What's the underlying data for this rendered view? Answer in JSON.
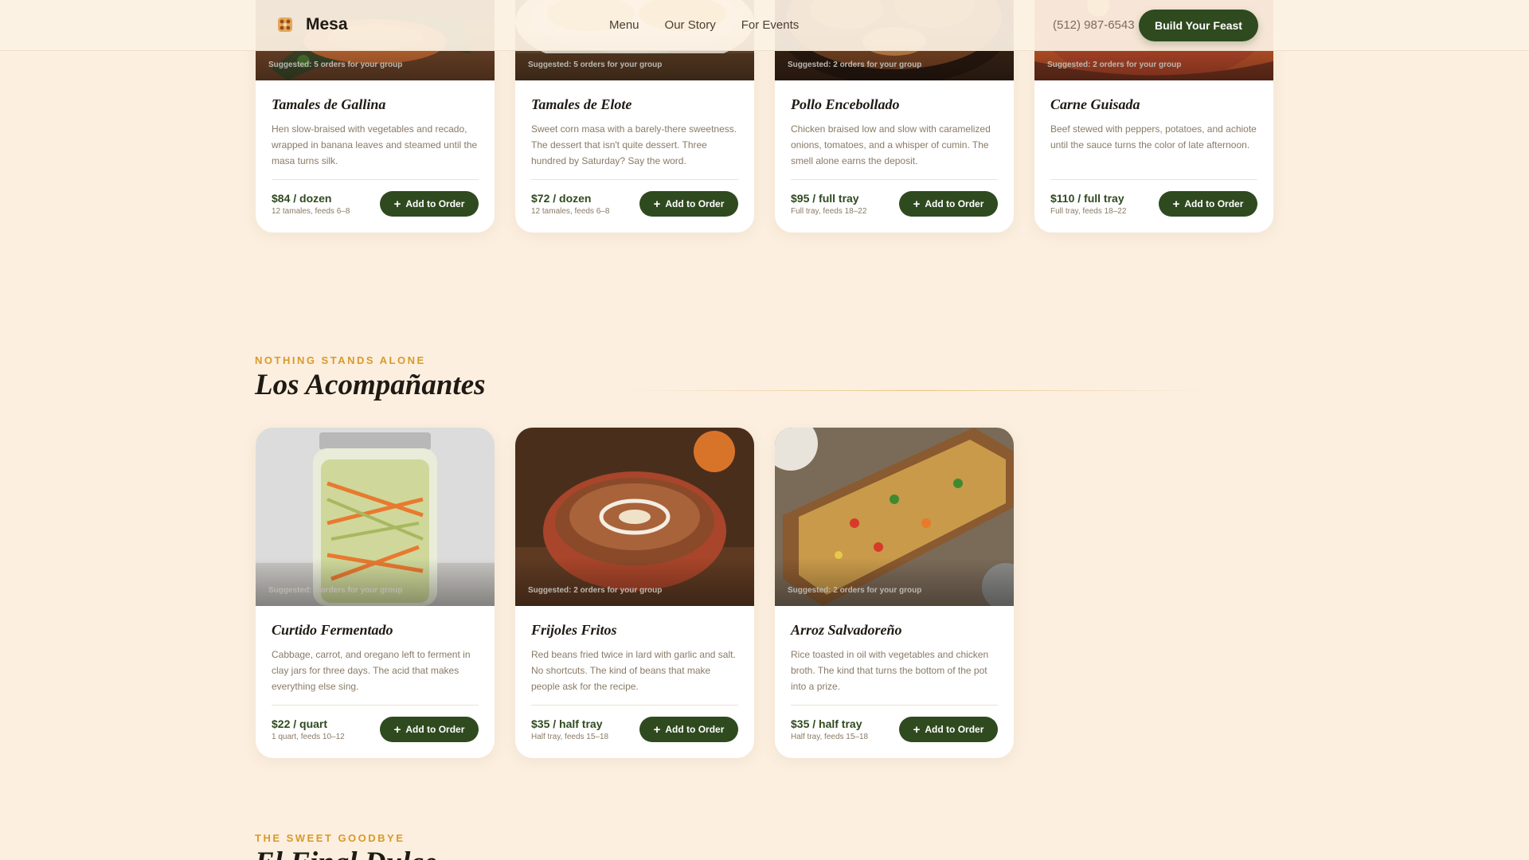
{
  "nav": {
    "brand": "Mesa",
    "links": [
      "Menu",
      "Our Story",
      "For Events"
    ],
    "phone": "(512) 987-6543",
    "cta": "Build Your Feast"
  },
  "colors": {
    "background": "#fcefdf",
    "accent_green": "#2f4a1f",
    "eyebrow_gold": "#d79a2b"
  },
  "add_label": "Add to Order",
  "add_icon": "plus-icon",
  "mains": [
    {
      "suggest": "Suggested: 5 orders for your group",
      "name": "Tamales de Gallina",
      "desc": "Hen slow-braised with vegetables and recado, wrapped in banana leaves and steamed until the masa turns silk.",
      "price": "$84 / dozen",
      "serves": "12 tamales, feeds 6–8"
    },
    {
      "suggest": "Suggested: 5 orders for your group",
      "name": "Tamales de Elote",
      "desc": "Sweet corn masa with a barely-there sweetness. The dessert that isn't quite dessert. Three hundred by Saturday? Say the word.",
      "price": "$72 / dozen",
      "serves": "12 tamales, feeds 6–8"
    },
    {
      "suggest": "Suggested: 2 orders for your group",
      "name": "Pollo Encebollado",
      "desc": "Chicken braised low and slow with caramelized onions, tomatoes, and a whisper of cumin. The smell alone earns the deposit.",
      "price": "$95 / full tray",
      "serves": "Full tray, feeds 18–22"
    },
    {
      "suggest": "Suggested: 2 orders for your group",
      "name": "Carne Guisada",
      "desc": "Beef stewed with peppers, potatoes, and achiote until the sauce turns the color of late afternoon.",
      "price": "$110 / full tray",
      "serves": "Full tray, feeds 18–22"
    }
  ],
  "sides_section": {
    "eyebrow": "NOTHING STANDS ALONE",
    "title": "Los Acompañantes"
  },
  "sides": [
    {
      "suggest": "Suggested: 3 orders for your group",
      "name": "Curtido Fermentado",
      "desc": "Cabbage, carrot, and oregano left to ferment in clay jars for three days. The acid that makes everything else sing.",
      "price": "$22 / quart",
      "serves": "1 quart, feeds 10–12"
    },
    {
      "suggest": "Suggested: 2 orders for your group",
      "name": "Frijoles Fritos",
      "desc": "Red beans fried twice in lard with garlic and salt. No shortcuts. The kind of beans that make people ask for the recipe.",
      "price": "$35 / half tray",
      "serves": "Half tray, feeds 15–18"
    },
    {
      "suggest": "Suggested: 2 orders for your group",
      "name": "Arroz Salvadoreño",
      "desc": "Rice toasted in oil with vegetables and chicken broth. The kind that turns the bottom of the pot into a prize.",
      "price": "$35 / half tray",
      "serves": "Half tray, feeds 15–18"
    }
  ],
  "dessert_section": {
    "eyebrow": "THE SWEET GOODBYE",
    "title": "El Final Dulce"
  }
}
